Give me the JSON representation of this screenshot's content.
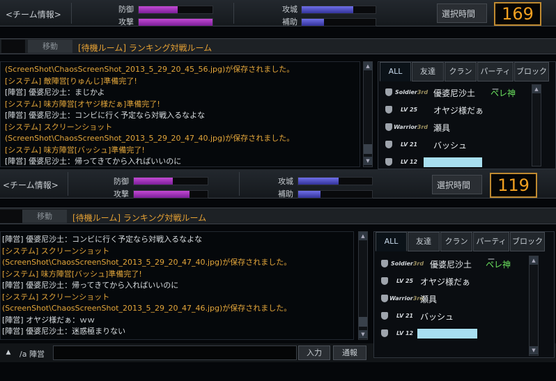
{
  "top": {
    "header": {
      "team_info": "<チーム情報>",
      "defense_label": "防御",
      "attack_label": "攻撃",
      "siege_label": "攻城",
      "support_label": "補助",
      "select_time_label": "選択時間",
      "timer_value": "169",
      "levels": {
        "defense": 0.53,
        "attack": 1.0,
        "siege": 0.7,
        "support": 0.3
      }
    },
    "room": {
      "move_label": "移動",
      "title": "[待機ルーム] ランキング対戦ルーム"
    },
    "chat": [
      {
        "text": "(ScreenShot\\ChaosScreenShot_2013_5_29_20_45_56.jpg)が保存されました。",
        "kind": "system"
      },
      {
        "text": "[システム] 敵陣営[りゅんじ]準備完了!",
        "kind": "system"
      },
      {
        "text": "[陣営] 優婆尼沙土：まじかよ",
        "kind": "team"
      },
      {
        "text": "[システム] 味方陣営[オヤジ様だぁ]準備完了!",
        "kind": "system"
      },
      {
        "text": "[陣営] 優婆尼沙土：コンビに行く予定なら対戦入るなよな",
        "kind": "team"
      },
      {
        "text": "[システム] スクリーンショット",
        "kind": "system"
      },
      {
        "text": "(ScreenShot\\ChaosScreenShot_2013_5_29_20_47_40.jpg)が保存されました。",
        "kind": "system"
      },
      {
        "text": "[システム] 味方陣営[バッシュ]準備完了!",
        "kind": "system"
      },
      {
        "text": "[陣営] 優婆尼沙土：帰ってきてから入ればいいのに",
        "kind": "team"
      }
    ],
    "tabs": [
      "ALL",
      "友達",
      "クラン",
      "パーティー",
      "ブロック"
    ],
    "players": [
      {
        "rank": "Soldier 3rd",
        "name": "優婆尼沙土",
        "guild": "ペレ神"
      },
      {
        "rank": "LV 25",
        "name": "オヤジ様だぁ",
        "guild": ""
      },
      {
        "rank": "Warrior 3rd",
        "name": "瀬具",
        "guild": ""
      },
      {
        "rank": "LV 21",
        "name": "バッシュ",
        "guild": ""
      },
      {
        "rank": "LV 12",
        "name": "",
        "guild": ""
      }
    ]
  },
  "bottom": {
    "header": {
      "team_info": "<チーム情報>",
      "defense_label": "防御",
      "attack_label": "攻撃",
      "siege_label": "攻城",
      "support_label": "補助",
      "select_time_label": "選択時間",
      "timer_value": "119",
      "levels": {
        "defense": 0.53,
        "attack": 0.75,
        "siege": 0.55,
        "support": 0.3
      }
    },
    "room": {
      "move_label": "移動",
      "title": "[待機ルーム] ランキング対戦ルーム"
    },
    "chat": [
      {
        "text": "[陣営] 優婆尼沙土：コンビに行く予定なら対戦入るなよな",
        "kind": "team"
      },
      {
        "text": "[システム] スクリーンショット",
        "kind": "system"
      },
      {
        "text": "(ScreenShot\\ChaosScreenShot_2013_5_29_20_47_40.jpg)が保存されました。",
        "kind": "system"
      },
      {
        "text": "[システム] 味方陣営[バッシュ]準備完了!",
        "kind": "system"
      },
      {
        "text": "[陣営] 優婆尼沙土：帰ってきてから入ればいいのに",
        "kind": "team"
      },
      {
        "text": "[システム] スクリーンショット",
        "kind": "system"
      },
      {
        "text": "(ScreenShot\\ChaosScreenShot_2013_5_29_20_47_46.jpg)が保存されました。",
        "kind": "system"
      },
      {
        "text": "[陣営] オヤジ様だぁ：ｗｗ",
        "kind": "team"
      },
      {
        "text": "[陣営] 優婆尼沙土：迷惑極まりない",
        "kind": "team"
      }
    ],
    "tabs": [
      "ALL",
      "友達",
      "クラン",
      "パーティー",
      "ブロック"
    ],
    "players": [
      {
        "rank": "Soldier 3rd",
        "name": "優婆尼沙土",
        "guild": "ペレ神"
      },
      {
        "rank": "LV 25",
        "name": "オヤジ様だぁ",
        "guild": ""
      },
      {
        "rank": "Warrior 3rd",
        "name": "瀬具",
        "guild": ""
      },
      {
        "rank": "LV 21",
        "name": "バッシュ",
        "guild": ""
      },
      {
        "rank": "LV 12",
        "name": "",
        "guild": ""
      }
    ],
    "input": {
      "arrow": "▲",
      "channel": "/a 陣営",
      "value": "",
      "enter_label": "入力",
      "report_label": "通報"
    }
  },
  "colors": {
    "system_text": "#e3a63a",
    "team_text": "#d8dde0",
    "defense_bar": "#c34ad4",
    "siege_bar": "#5555cc",
    "timer": "#f2a020",
    "guild": "#6be25e"
  }
}
